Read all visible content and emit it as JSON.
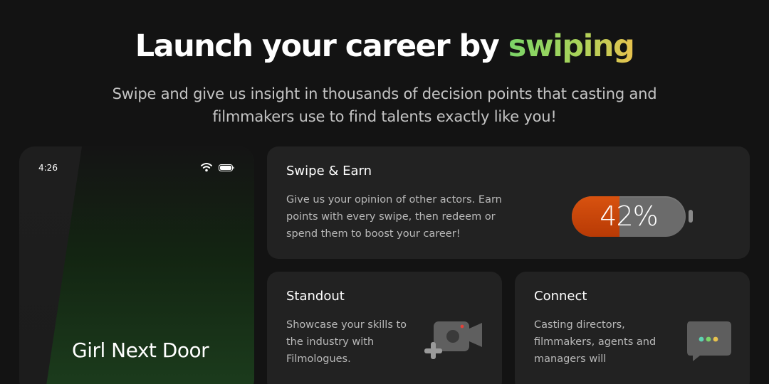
{
  "hero": {
    "title_prefix": "Launch your career by ",
    "title_accent": "swiping",
    "subtitle": "Swipe and give us insight in thousands of decision points that casting and filmmakers use to find talents exactly like you!"
  },
  "phone": {
    "status_time": "4:26",
    "caption": "Girl Next Door"
  },
  "cards": {
    "swipe": {
      "title": "Swipe & Earn",
      "body": "Give us your opinion of other actors. Earn points with every swipe, then redeem or spend them to boost your career!",
      "meter_label": "42%",
      "meter_percent": 42
    },
    "standout": {
      "title": "Standout",
      "body": "Showcase your skills to the industry with Filmologues."
    },
    "connect": {
      "title": "Connect",
      "body": "Casting directors, filmmakers, agents and managers will"
    }
  },
  "icons": {
    "wifi": "wifi-icon",
    "battery": "battery-icon",
    "camera": "video-camera-add-icon",
    "chat": "chat-bubble-icon"
  },
  "colors": {
    "background": "#131313",
    "card": "#222222",
    "accent_green": "#7bd468",
    "accent_yellow": "#e8c24e",
    "meter_fill": "#c9470a"
  }
}
